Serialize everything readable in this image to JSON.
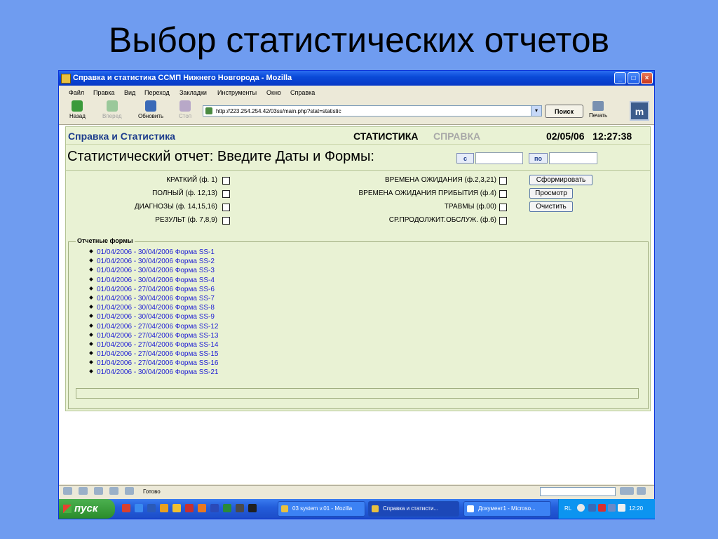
{
  "slide": {
    "title": "Выбор статистических отчетов"
  },
  "window": {
    "title": "Справка и статистика ССМП Нижнего Новгорода - Mozilla",
    "controls": {
      "minimize": "_",
      "maximize": "□",
      "close": "×"
    }
  },
  "menu": [
    "Файл",
    "Правка",
    "Вид",
    "Переход",
    "Закладки",
    "Инструменты",
    "Окно",
    "Справка"
  ],
  "toolbar": {
    "back": "Назад",
    "forward": "Вперед",
    "reload": "Обновить",
    "stop": "Стоп",
    "address": "http://223.254.254.42/03ss/main.php?stat=statistic",
    "search": "Поиск",
    "print": "Печать",
    "brand_letter": "m"
  },
  "page": {
    "app_name": "Справка и Статистика",
    "nav_active": "СТАТИСТИКА",
    "nav_inactive": "СПРАВКА",
    "date": "02/05/06",
    "time": "12:27:38",
    "prompt": "Статистический отчет: Введите Даты и Формы:",
    "from_label": "с",
    "to_label": "по",
    "from_value": "",
    "to_value": ""
  },
  "options_left": [
    {
      "label": "КРАТКИЙ (ф. 1)",
      "checked": false
    },
    {
      "label": "ПОЛНЫЙ (ф. 12,13)",
      "checked": false
    },
    {
      "label": "ДИАГНОЗЫ (ф. 14,15,16)",
      "checked": false
    },
    {
      "label": "РЕЗУЛЬТ (ф. 7,8,9)",
      "checked": false
    }
  ],
  "options_right": [
    {
      "label": "ВРЕМЕНА ОЖИДАНИЯ (ф.2,3,21)",
      "checked": false
    },
    {
      "label": "ВРЕМЕНА ОЖИДАНИЯ ПРИБЫТИЯ (ф.4)",
      "checked": false
    },
    {
      "label": "ТРАВМЫ (ф.00)",
      "checked": false
    },
    {
      "label": "СР.ПРОДОЛЖИТ.ОБСЛУЖ. (ф.6)",
      "checked": false
    }
  ],
  "actions": {
    "generate": "Сформировать",
    "view": "Просмотр",
    "clear": "Очистить"
  },
  "forms": {
    "legend": "Отчетные формы",
    "items": [
      "01/04/2006 - 30/04/2006 Форма SS-1",
      "01/04/2006 - 30/04/2006 Форма SS-2",
      "01/04/2006 - 30/04/2006 Форма SS-3",
      "01/04/2006 - 30/04/2006 Форма SS-4",
      "01/04/2006 - 27/04/2006 Форма SS-6",
      "01/04/2006 - 30/04/2006 Форма SS-7",
      "01/04/2006 - 30/04/2006 Форма SS-8",
      "01/04/2006 - 30/04/2006 Форма SS-9",
      "01/04/2006 - 27/04/2006 Форма SS-12",
      "01/04/2006 - 27/04/2006 Форма SS-13",
      "01/04/2006 - 27/04/2006 Форма SS-14",
      "01/04/2006 - 27/04/2006 Форма SS-15",
      "01/04/2006 - 27/04/2006 Форма SS-16",
      "01/04/2006 - 30/04/2006 Форма SS-21"
    ]
  },
  "status": {
    "text": "Готово"
  },
  "taskbar": {
    "start": "пуск",
    "tasks": [
      {
        "label": "03 system v.01 - Mozilla",
        "active": false
      },
      {
        "label": "Справка и статисти...",
        "active": true
      },
      {
        "label": "Документ1 - Microso...",
        "active": false
      }
    ],
    "lang": "RL",
    "clock": "12:20"
  }
}
